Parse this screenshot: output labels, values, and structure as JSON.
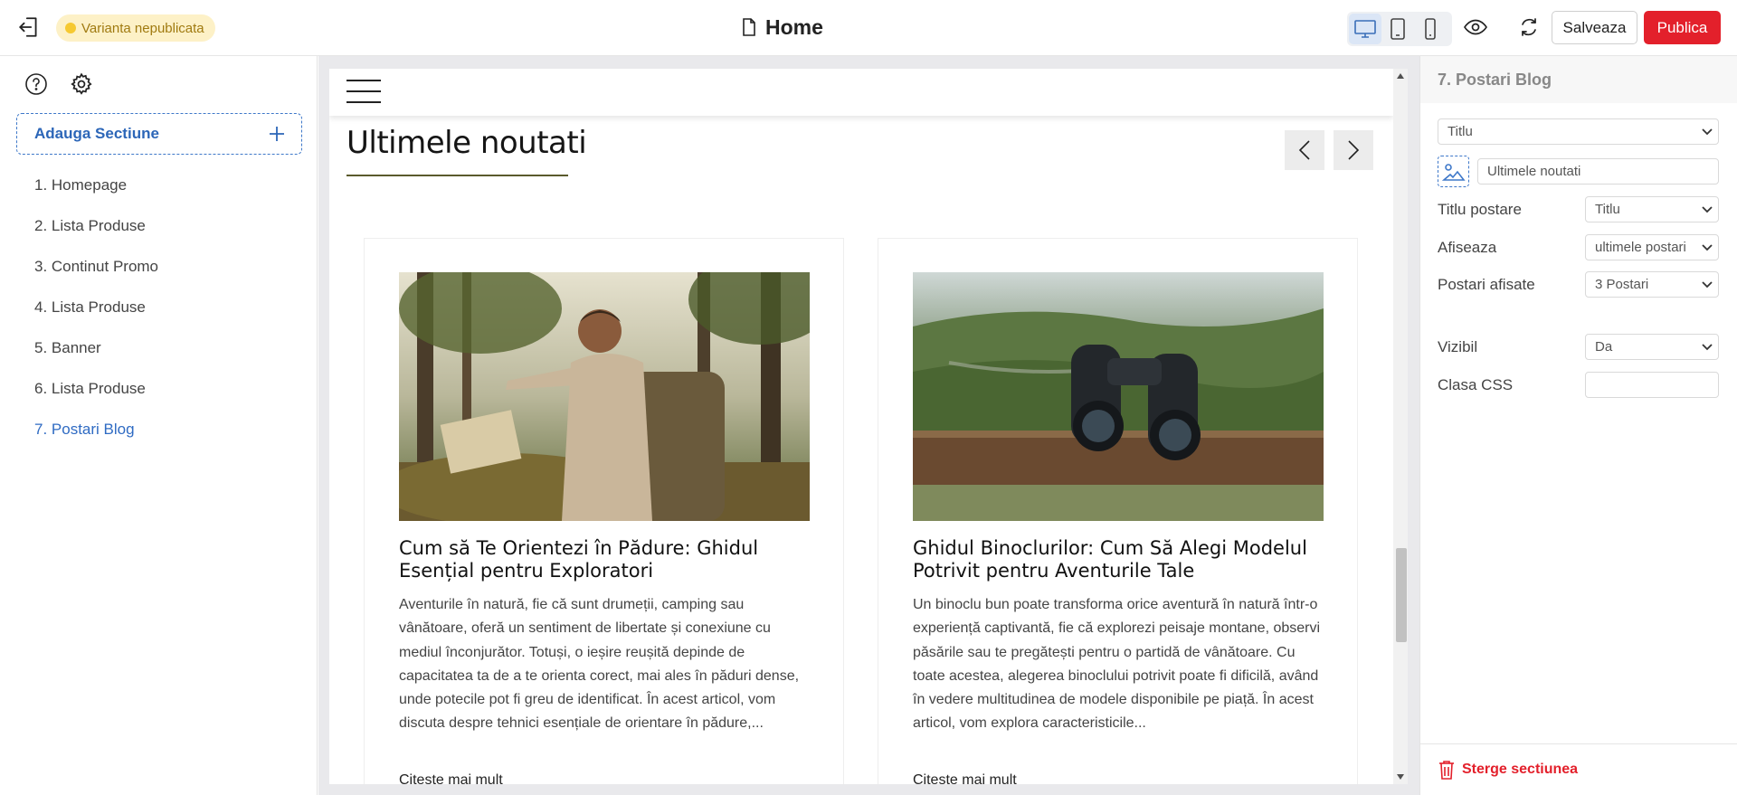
{
  "topbar": {
    "exit_icon": "exit-icon",
    "status_badge": "Varianta nepublicata",
    "page_title": "Home",
    "page_icon": "document-icon",
    "device_modes": [
      "desktop",
      "tablet",
      "mobile"
    ],
    "active_device": "desktop",
    "save_label": "Salveaza",
    "publish_label": "Publica",
    "accent_color": "#e3202b"
  },
  "sidebar": {
    "tools": [
      "help-icon",
      "gear-icon"
    ],
    "add_section_label": "Adauga Sectiune",
    "sections": [
      {
        "label": "1. Homepage",
        "active": false
      },
      {
        "label": "2. Lista Produse",
        "active": false
      },
      {
        "label": "3. Continut Promo",
        "active": false
      },
      {
        "label": "4. Lista Produse",
        "active": false
      },
      {
        "label": "5. Banner",
        "active": false
      },
      {
        "label": "6. Lista Produse",
        "active": false
      },
      {
        "label": "7. Postari Blog",
        "active": true
      }
    ]
  },
  "canvas": {
    "blog_title": "Ultimele noutati",
    "posts": [
      {
        "title": "Cum să Te Orientezi în Pădure: Ghidul Esențial pentru Exploratori",
        "excerpt": "Aventurile în natură, fie că sunt drumeții, camping sau vânătoare, oferă un sentiment de libertate și conexiune cu mediul înconjurător. Totuși, o ieșire reușită depinde de capacitatea ta de a te orienta corect, mai ales în păduri dense, unde potecile pot fi greu de identificat. În acest articol, vom discuta despre tehnici esențiale de orientare în pădure,...",
        "read_more": "Citeste mai mult",
        "image": "hiker-with-map-in-forest"
      },
      {
        "title": "Ghidul Binoclurilor: Cum Să Alegi Modelul Potrivit pentru Aventurile Tale",
        "excerpt": "Un binoclu bun poate transforma orice aventură în natură într-o experiență captivantă, fie că explorezi peisaje montane, observi păsările sau te pregătești pentru o partidă de vânătoare. Cu toate acestea, alegerea binoclului potrivit poate fi dificilă, având în vedere multitudinea de modele disponibile pe piață. În acest articol, vom explora caracteristicile...",
        "read_more": "Citeste mai mult",
        "image": "binoculars-on-wooden-rail"
      }
    ]
  },
  "panel": {
    "title": "7. Postari Blog",
    "title_type_select": "Titlu",
    "title_text": "Ultimele noutati",
    "fields": [
      {
        "label": "Titlu postare",
        "value": "Titlu"
      },
      {
        "label": "Afiseaza",
        "value": "ultimele postari"
      },
      {
        "label": "Postari afisate",
        "value": "3 Postari"
      },
      {
        "label": "Vizibil",
        "value": "Da"
      },
      {
        "label": "Clasa CSS",
        "value": ""
      }
    ],
    "delete_label": "Sterge sectiunea"
  }
}
